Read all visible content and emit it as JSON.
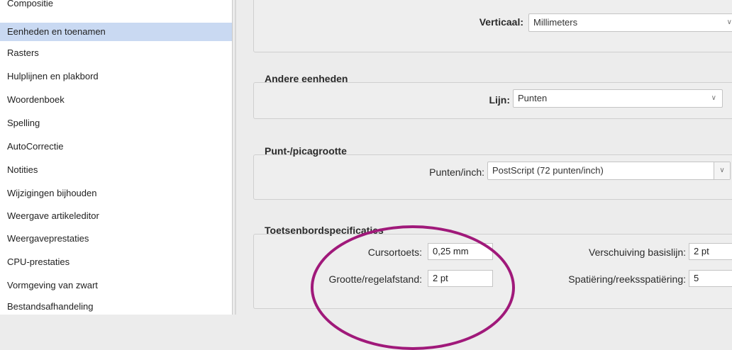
{
  "sidebar": {
    "items": [
      {
        "label": "Compositie"
      },
      {
        "label": "Eenheden en toenamen",
        "selected": true
      },
      {
        "label": "Rasters"
      },
      {
        "label": "Hulplijnen en plakbord"
      },
      {
        "label": "Woordenboek"
      },
      {
        "label": "Spelling"
      },
      {
        "label": "AutoCorrectie"
      },
      {
        "label": "Notities"
      },
      {
        "label": "Wijzigingen bijhouden"
      },
      {
        "label": "Weergave artikeleditor"
      },
      {
        "label": "Weergaveprestaties"
      },
      {
        "label": "CPU-prestaties"
      },
      {
        "label": "Vormgeving van zwart"
      },
      {
        "label": "Bestandsafhandeling"
      }
    ]
  },
  "ruler_units": {
    "vertical_label": "Verticaal:",
    "vertical_value": "Millimeters"
  },
  "other_units": {
    "title": "Andere eenheden",
    "line_label": "Lijn:",
    "line_value": "Punten"
  },
  "point_size": {
    "title": "Punt-/picagrootte",
    "points_label": "Punten/inch:",
    "points_value": "PostScript (72 punten/inch)"
  },
  "keyboard": {
    "title": "Toetsenbordspecificaties",
    "cursor_label": "Cursortoets:",
    "cursor_value": "0,25 mm",
    "size_label": "Grootte/regelafstand:",
    "size_value": "2 pt",
    "baseline_label": "Verschuiving basislijn:",
    "baseline_value": "2 pt",
    "tracking_label": "Spatiëring/reeksspatiëring:",
    "tracking_value": "5"
  },
  "annotation_color": "#a0197a"
}
